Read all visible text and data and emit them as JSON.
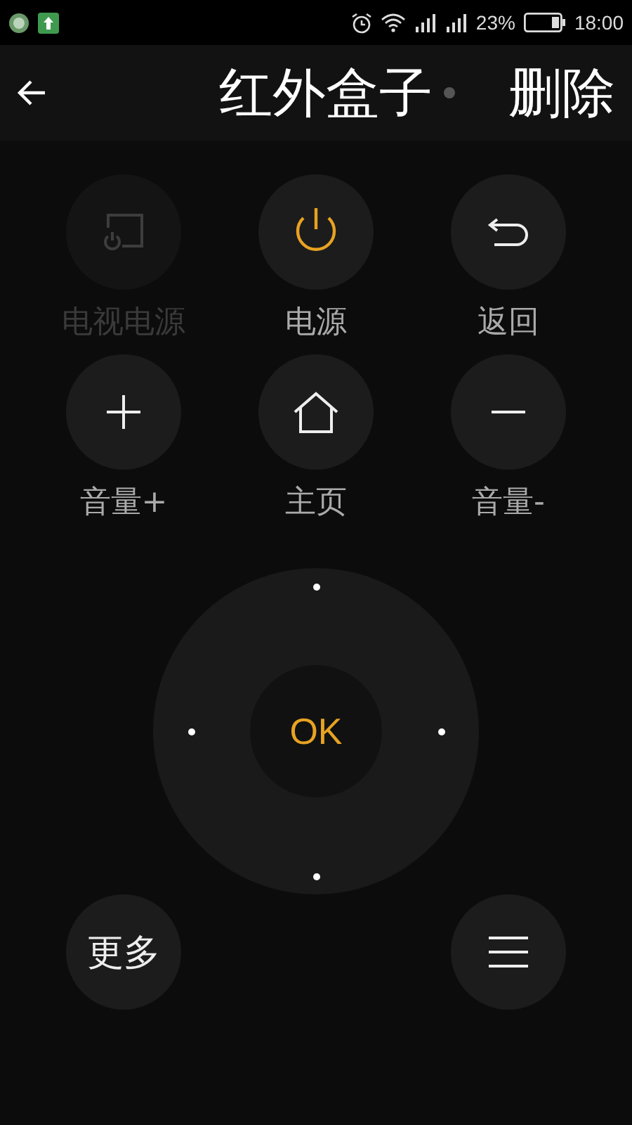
{
  "status_bar": {
    "battery": "23%",
    "time": "18:00"
  },
  "header": {
    "title": "红外盒子",
    "action": "删除"
  },
  "buttons": [
    {
      "kind": "tv_power",
      "label": "电视电源",
      "disabled": true
    },
    {
      "kind": "power",
      "label": "电源",
      "disabled": false
    },
    {
      "kind": "back",
      "label": "返回",
      "disabled": false
    },
    {
      "kind": "plus",
      "label": "音量+",
      "disabled": false
    },
    {
      "kind": "home",
      "label": "主页",
      "disabled": false
    },
    {
      "kind": "minus",
      "label": "音量-",
      "disabled": false
    }
  ],
  "dpad": {
    "ok": "OK"
  },
  "bottom": {
    "more": "更多"
  }
}
